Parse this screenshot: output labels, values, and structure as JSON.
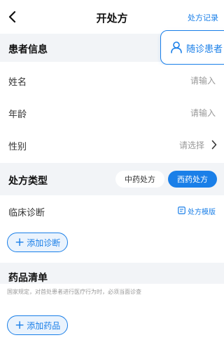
{
  "header": {
    "title": "开处方",
    "record_link": "处方记录"
  },
  "float_button": {
    "label": "随诊患者"
  },
  "patient_section": {
    "title": "患者信息"
  },
  "fields": {
    "name": {
      "label": "姓名",
      "placeholder": "请输入"
    },
    "age": {
      "label": "年龄",
      "placeholder": "请输入"
    },
    "gender": {
      "label": "性别",
      "placeholder": "请选择"
    }
  },
  "prescription_type": {
    "title": "处方类型",
    "options": [
      "中药处方",
      "西药处方"
    ],
    "selected": "西药处方"
  },
  "diagnosis": {
    "label": "临床诊断",
    "template_link": "处方模版",
    "add_label": "添加诊断"
  },
  "drug_list": {
    "title": "药品清单",
    "notice": "国家规定，对首处患者进行医疗行为时，必须当面诊查",
    "add_label": "添加药品"
  },
  "colors": {
    "accent": "#1a7fe8",
    "section_bg": "#f2f4f7"
  }
}
